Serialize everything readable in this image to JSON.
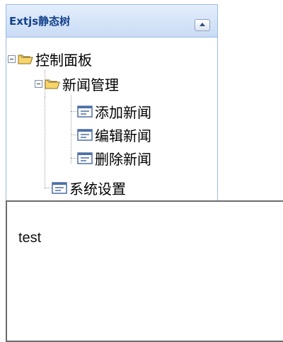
{
  "panel": {
    "title": "Extjs静态树",
    "collapse_tool_icon": "collapse-up-icon"
  },
  "tree": {
    "root": {
      "label": "控制面板",
      "expanded": true,
      "icon": "folder-open-icon",
      "children": [
        {
          "label": "新闻管理",
          "expanded": true,
          "icon": "folder-open-icon",
          "children": [
            {
              "label": "添加新闻",
              "icon": "leaf-page-icon"
            },
            {
              "label": "编辑新闻",
              "icon": "leaf-page-icon"
            },
            {
              "label": "删除新闻",
              "icon": "leaf-page-icon"
            }
          ]
        },
        {
          "label": "系统设置",
          "icon": "leaf-page-icon"
        }
      ]
    }
  },
  "content": {
    "text": "test"
  },
  "colors": {
    "panel_border": "#99bbe8",
    "title_text": "#15428b",
    "folder_fill": "#f7d56b"
  }
}
